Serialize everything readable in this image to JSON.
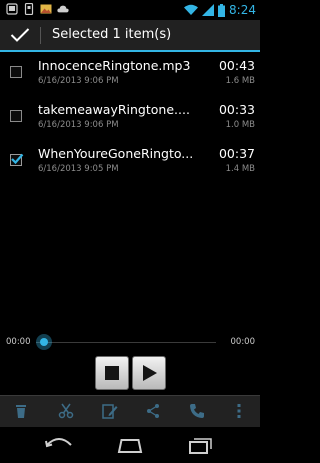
{
  "status_bar": {
    "time": "8:24",
    "notification_icons": [
      "phone-mockup-icon",
      "sim-card-icon",
      "image-icon",
      "cloud-icon"
    ],
    "right_icons": [
      "wifi-icon",
      "signal-icon",
      "battery-icon"
    ]
  },
  "action_bar": {
    "title": "Selected 1 item(s)",
    "done_icon": "checkmark-icon"
  },
  "files": [
    {
      "name": "InnocenceRingtone.mp3",
      "date": "6/16/2013 9:06 PM",
      "duration": "00:43",
      "size": "1.6 MB",
      "checked": false
    },
    {
      "name": "takemeawayRingtone....",
      "date": "6/16/2013 9:06 PM",
      "duration": "00:33",
      "size": "1.0 MB",
      "checked": false
    },
    {
      "name": "WhenYoureGoneRingto...",
      "date": "6/16/2013 9:05 PM",
      "duration": "00:37",
      "size": "1.4 MB",
      "checked": true
    }
  ],
  "player": {
    "current_time": "00:00",
    "total_time": "00:00",
    "progress": 0,
    "buttons": [
      "stop-icon",
      "play-icon"
    ]
  },
  "bottom_actions": [
    "trash-icon",
    "cut-icon",
    "edit-icon",
    "share-icon",
    "phone-icon",
    "overflow-menu-icon"
  ],
  "nav_bar": [
    "back-icon",
    "home-icon",
    "recent-apps-icon"
  ],
  "colors": {
    "accent": "#33b5e5",
    "background": "#000000",
    "bar": "#212121",
    "secondary_text": "#8c8c8c"
  }
}
